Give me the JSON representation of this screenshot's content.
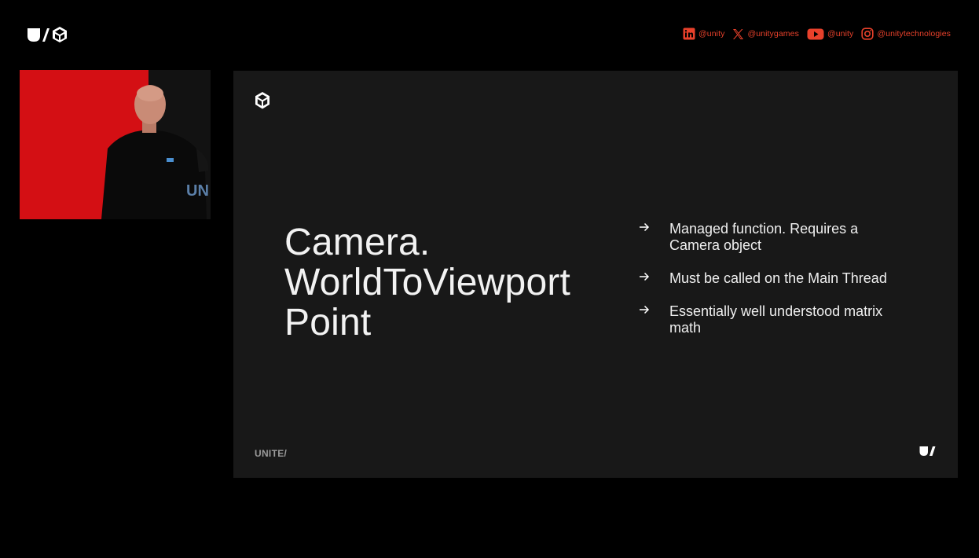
{
  "social": [
    {
      "icon": "linkedin-icon",
      "handle": "@unity"
    },
    {
      "icon": "x-icon",
      "handle": "@unitygames"
    },
    {
      "icon": "youtube-icon",
      "handle": "@unity"
    },
    {
      "icon": "instagram-icon",
      "handle": "@unitytechnologies"
    }
  ],
  "speaker_overlay_text": "UN",
  "slide": {
    "title_lines": [
      "Camera.",
      "WorldToViewport",
      "Point"
    ],
    "bullets": [
      "Managed function. Requires a Camera object",
      "Must be called on the Main Thread",
      "Essentially well understood matrix math"
    ],
    "footer_mark": "UNITE/"
  },
  "colors": {
    "background": "#000000",
    "slide_background": "#181818",
    "social_accent": "#e8412b",
    "speaker_backdrop": "#d40f14"
  }
}
